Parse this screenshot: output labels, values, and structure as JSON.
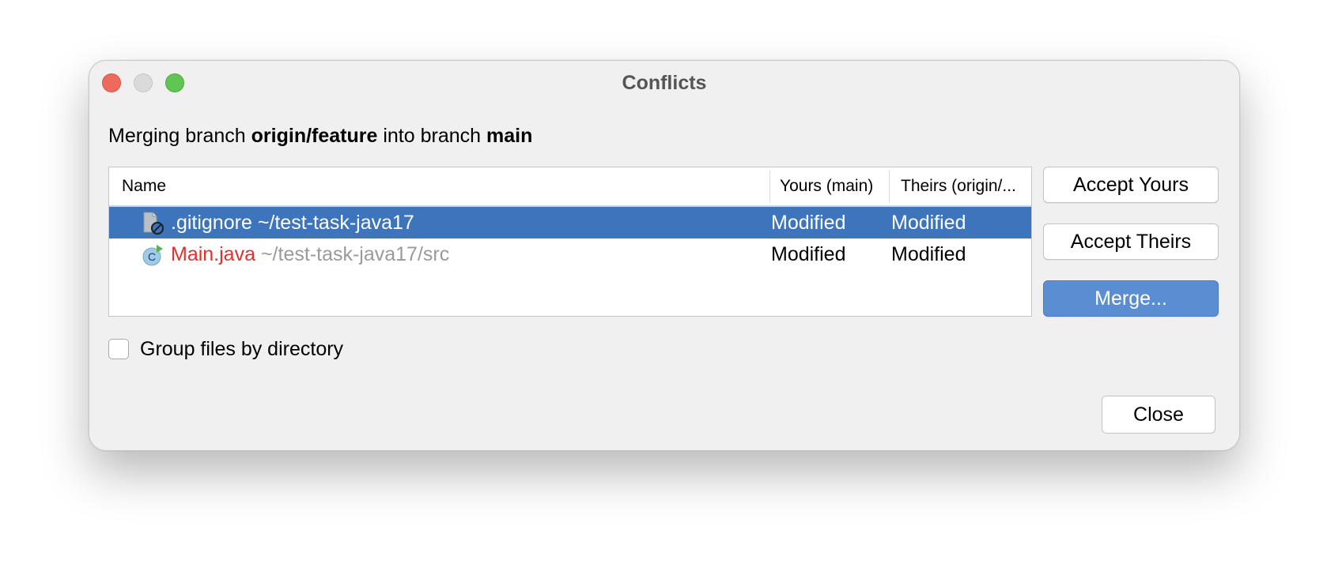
{
  "window": {
    "title": "Conflicts"
  },
  "subtitle": {
    "prefix": "Merging branch ",
    "source_branch": "origin/feature",
    "middle": " into branch ",
    "target_branch": "main"
  },
  "table": {
    "columns": {
      "name": "Name",
      "yours": "Yours (main)",
      "theirs": "Theirs (origin/..."
    },
    "rows": [
      {
        "icon": "ignored-file-icon",
        "file": ".gitignore",
        "path": "~/test-task-java17",
        "yours": "Modified",
        "theirs": "Modified",
        "selected": true
      },
      {
        "icon": "java-class-icon",
        "file": "Main.java",
        "path": "~/test-task-java17/src",
        "yours": "Modified",
        "theirs": "Modified",
        "selected": false
      }
    ]
  },
  "buttons": {
    "accept_yours": "Accept Yours",
    "accept_theirs": "Accept Theirs",
    "merge": "Merge...",
    "close": "Close"
  },
  "options": {
    "group_by_directory_label": "Group files by directory",
    "group_by_directory_checked": false
  },
  "colors": {
    "selection": "#3d74bc",
    "conflict_file": "#e0312a",
    "default_button": "#5b8dd3"
  }
}
